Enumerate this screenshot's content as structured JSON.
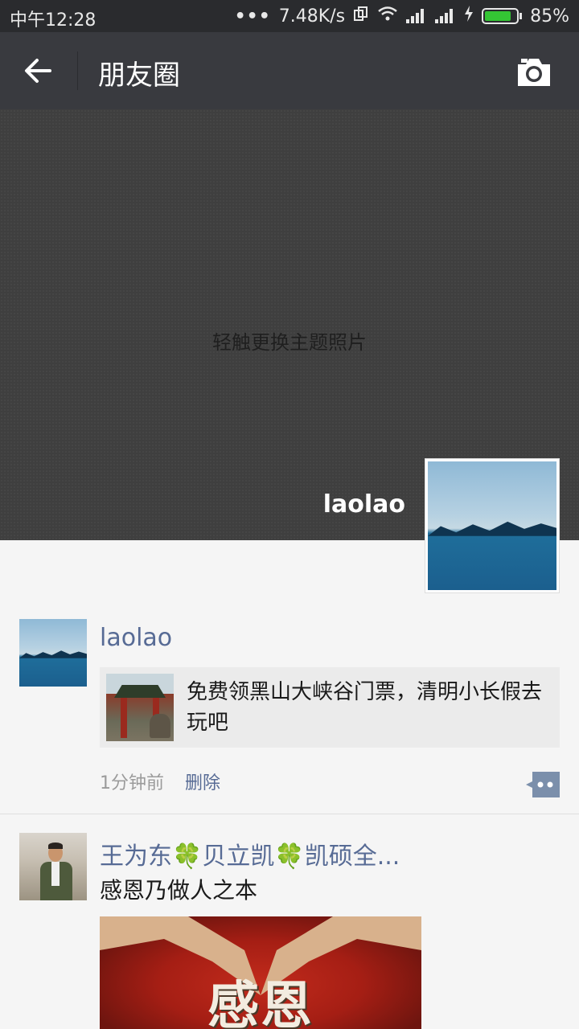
{
  "status_bar": {
    "time": "中午12:28",
    "network_speed": "7.48K/s",
    "battery_percent": "85%",
    "battery_level": 0.85
  },
  "header": {
    "title": "朋友圈",
    "back_icon": "arrow-left-icon",
    "camera_icon": "camera-icon"
  },
  "cover": {
    "hint": "轻触更换主题照片",
    "username": "laolao"
  },
  "posts": [
    {
      "author": "laolao",
      "share_title": "免费领黑山大峡谷门票，清明小长假去玩吧",
      "time": "1分钟前",
      "delete_label": "删除"
    },
    {
      "author": "王为东🍀贝立凯🍀凯硕全...",
      "text": "感恩乃做人之本",
      "image_text": "感恩"
    }
  ],
  "colors": {
    "header_bg": "#393a3f",
    "link_blue": "#576b95",
    "feed_bg": "#f5f5f5"
  }
}
